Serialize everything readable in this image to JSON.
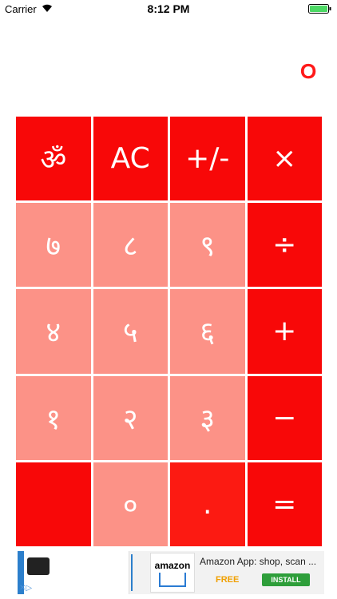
{
  "status_bar": {
    "carrier": "Carrier",
    "time": "8:12 PM"
  },
  "display": {
    "value": "०"
  },
  "keys": [
    {
      "label": "ॐ",
      "style": "dark"
    },
    {
      "label": "AC",
      "style": "dark"
    },
    {
      "label": "+/-",
      "style": "dark"
    },
    {
      "label": "×",
      "style": "dark"
    },
    {
      "label": "७",
      "style": "light"
    },
    {
      "label": "८",
      "style": "light"
    },
    {
      "label": "९",
      "style": "light"
    },
    {
      "label": "÷",
      "style": "dark"
    },
    {
      "label": "४",
      "style": "light"
    },
    {
      "label": "५",
      "style": "light"
    },
    {
      "label": "६",
      "style": "light"
    },
    {
      "label": "+",
      "style": "dark"
    },
    {
      "label": "१",
      "style": "light"
    },
    {
      "label": "२",
      "style": "light"
    },
    {
      "label": "३",
      "style": "light"
    },
    {
      "label": "−",
      "style": "dark"
    },
    {
      "label": "",
      "style": "dark"
    },
    {
      "label": "०",
      "style": "light"
    },
    {
      "label": ".",
      "style": "dot"
    },
    {
      "label": "=",
      "style": "dark"
    }
  ],
  "ad": {
    "title": "Amazon App: shop, scan ...",
    "free_label": "FREE",
    "install_label": "INSTALL",
    "logo_text": "amazon"
  },
  "colors": {
    "accent_dark": "#f80808",
    "accent_light": "#fc9287",
    "display_text": "#ff1a1a"
  }
}
